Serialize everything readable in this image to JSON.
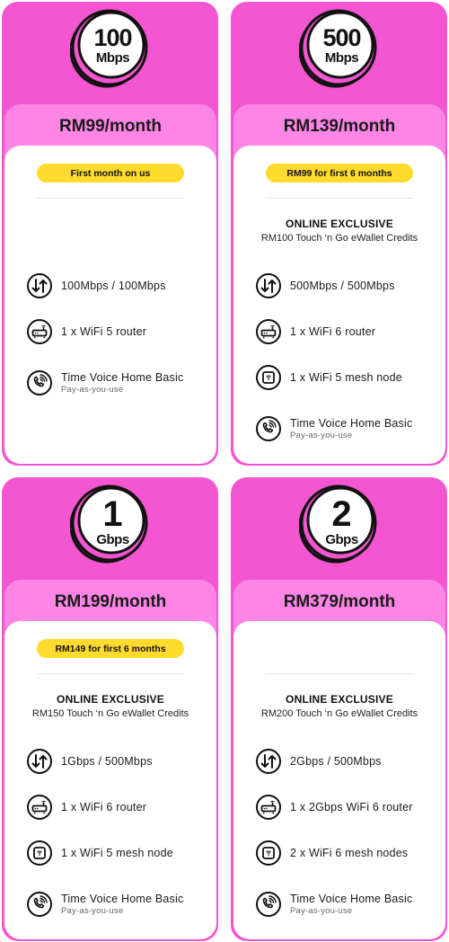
{
  "colors": {
    "card_outer": "#f455d0",
    "price_panel": "#fd85e6",
    "promo": "#ffdb2e",
    "badge_ring": "#d23ab6"
  },
  "plans": [
    {
      "speed_value": "100",
      "speed_unit": "Mbps",
      "price": "RM99/month",
      "promo": "First month on us",
      "exclusive_title": null,
      "exclusive_sub": null,
      "features": [
        {
          "icon": "up-down-arrows-icon",
          "text": "100Mbps / 100Mbps"
        },
        {
          "icon": "router-icon",
          "text": "1 x WiFi 5 router"
        },
        {
          "icon": "phone-call-icon",
          "text": "Time Voice Home Basic",
          "sub": "Pay-as-you-use"
        }
      ]
    },
    {
      "speed_value": "500",
      "speed_unit": "Mbps",
      "price": "RM139/month",
      "promo": "RM99 for first 6 months",
      "exclusive_title": "ONLINE EXCLUSIVE",
      "exclusive_sub": "RM100 Touch ‘n Go eWallet Credits",
      "features": [
        {
          "icon": "up-down-arrows-icon",
          "text": "500Mbps / 500Mbps"
        },
        {
          "icon": "router-icon",
          "text": "1 x WiFi 6 router"
        },
        {
          "icon": "mesh-node-icon",
          "text": "1 x WiFi 5 mesh node"
        },
        {
          "icon": "phone-call-icon",
          "text": "Time Voice Home Basic",
          "sub": "Pay-as-you-use"
        }
      ]
    },
    {
      "speed_value": "1",
      "speed_unit": "Gbps",
      "price": "RM199/month",
      "promo": "RM149 for first 6 months",
      "exclusive_title": "ONLINE EXCLUSIVE",
      "exclusive_sub": "RM150 Touch ‘n Go eWallet Credits",
      "features": [
        {
          "icon": "up-down-arrows-icon",
          "text": "1Gbps / 500Mbps"
        },
        {
          "icon": "router-icon",
          "text": "1 x WiFi 6 router"
        },
        {
          "icon": "mesh-node-icon",
          "text": "1 x WiFi 5 mesh node"
        },
        {
          "icon": "phone-call-icon",
          "text": "Time Voice Home Basic",
          "sub": "Pay-as-you-use"
        }
      ]
    },
    {
      "speed_value": "2",
      "speed_unit": "Gbps",
      "price": "RM379/month",
      "promo": null,
      "exclusive_title": "ONLINE EXCLUSIVE",
      "exclusive_sub": "RM200 Touch ‘n Go eWallet Credits",
      "features": [
        {
          "icon": "up-down-arrows-icon",
          "text": "2Gbps / 500Mbps"
        },
        {
          "icon": "router-icon",
          "text": "1 x 2Gbps WiFi 6 router"
        },
        {
          "icon": "mesh-node-icon",
          "text": "2 x WiFi 6 mesh nodes"
        },
        {
          "icon": "phone-call-icon",
          "text": "Time Voice Home Basic",
          "sub": "Pay-as-you-use"
        }
      ]
    }
  ]
}
